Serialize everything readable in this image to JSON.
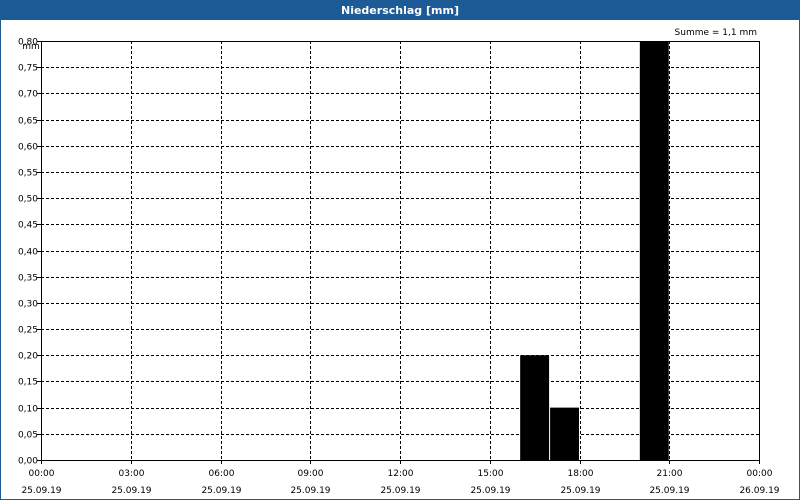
{
  "window": {
    "title": "Niederschlag [mm]"
  },
  "chart_data": {
    "type": "bar",
    "title": "Niederschlag [mm]",
    "ylabel": "mm",
    "xlabel": "",
    "annotation": "Summe = 1,1 mm",
    "ylim": [
      0,
      0.8
    ],
    "yticks": [
      "0,00",
      "0,05",
      "0,10",
      "0,15",
      "0,20",
      "0,25",
      "0,30",
      "0,35",
      "0,40",
      "0,45",
      "0,50",
      "0,55",
      "0,60",
      "0,65",
      "0,70",
      "0,75",
      "0,80"
    ],
    "xlim": [
      "25.09.19 00:00",
      "26.09.19 00:00"
    ],
    "xticks": [
      {
        "time": "00:00",
        "date": "25.09.19"
      },
      {
        "time": "03:00",
        "date": "25.09.19"
      },
      {
        "time": "06:00",
        "date": "25.09.19"
      },
      {
        "time": "09:00",
        "date": "25.09.19"
      },
      {
        "time": "12:00",
        "date": "25.09.19"
      },
      {
        "time": "15:00",
        "date": "25.09.19"
      },
      {
        "time": "18:00",
        "date": "25.09.19"
      },
      {
        "time": "21:00",
        "date": "25.09.19"
      },
      {
        "time": "00:00",
        "date": "26.09.19"
      }
    ],
    "grid": true,
    "bar_color": "#000000",
    "bars": [
      {
        "start": "25.09.19 16:00",
        "end": "25.09.19 17:00",
        "value": 0.2
      },
      {
        "start": "25.09.19 17:00",
        "end": "25.09.19 18:00",
        "value": 0.1
      },
      {
        "start": "25.09.19 20:00",
        "end": "25.09.19 21:00",
        "value": 0.8
      }
    ]
  }
}
